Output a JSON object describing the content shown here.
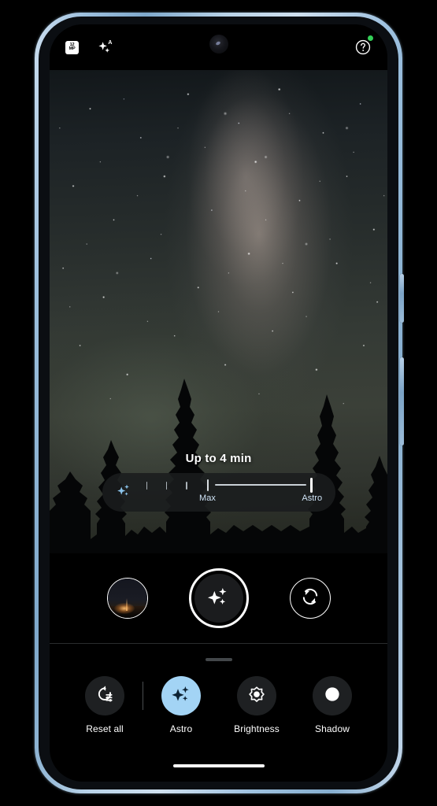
{
  "app": {
    "name": "Camera",
    "mode": "Astro"
  },
  "device": {
    "frame_color": "#9dc0de",
    "screen_background": "#000000"
  },
  "topbar": {
    "resolution_badge": {
      "icon": "resolution-badge-icon",
      "line1": "12",
      "line2": "MP"
    },
    "night_sight_icon": "night-sight-auto-icon",
    "help_icon": "help-icon",
    "privacy_indicator": {
      "name": "camera-in-use-indicator",
      "color": "#34d058"
    }
  },
  "viewfinder": {
    "scene": "milky-way-night-sky-with-pine-trees",
    "duration_label": "Up to 4 min"
  },
  "exposure_slider": {
    "icon": "astro-sparkle-icon",
    "accent_color": "#a3d4f5",
    "ticks": 4,
    "labels": {
      "max": "Max",
      "astro": "Astro"
    },
    "selected": "Astro",
    "max_position_pct": 36,
    "thumb_position_pct": 94
  },
  "shutter_row": {
    "thumbnail": {
      "name": "gallery-thumbnail",
      "alt": "last-photo-night-landscape"
    },
    "shutter": {
      "name": "shutter-button",
      "icon": "astro-sparkle-icon"
    },
    "flip": {
      "name": "switch-camera-button",
      "icon": "camera-flip-icon"
    }
  },
  "bottom_sheet": {
    "handle": "drag-handle",
    "controls": [
      {
        "id": "reset-all",
        "label": "Reset all",
        "icon": "reset-all-icon",
        "active": false
      },
      {
        "id": "astro",
        "label": "Astro",
        "icon": "astro-sparkle-icon",
        "active": true
      },
      {
        "id": "brightness",
        "label": "Brightness",
        "icon": "brightness-icon",
        "active": false
      },
      {
        "id": "shadow",
        "label": "Shadow",
        "icon": "shadow-icon",
        "active": false
      }
    ]
  },
  "navigation": {
    "gesture_bar": "home-gesture-bar"
  }
}
